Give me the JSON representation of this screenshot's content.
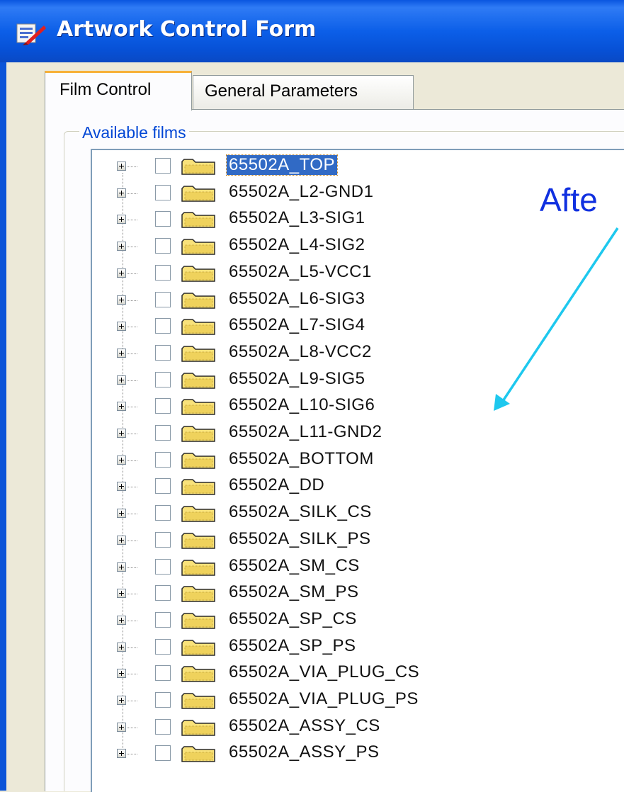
{
  "window": {
    "title": "Artwork Control Form"
  },
  "tabs": [
    {
      "label": "Film Control",
      "active": true
    },
    {
      "label": "General Parameters",
      "active": false
    }
  ],
  "group": {
    "label": "Available films"
  },
  "films": [
    {
      "name": "65502A_TOP",
      "selected": true
    },
    {
      "name": "65502A_L2-GND1"
    },
    {
      "name": "65502A_L3-SIG1"
    },
    {
      "name": "65502A_L4-SIG2"
    },
    {
      "name": "65502A_L5-VCC1"
    },
    {
      "name": "65502A_L6-SIG3"
    },
    {
      "name": "65502A_L7-SIG4"
    },
    {
      "name": "65502A_L8-VCC2"
    },
    {
      "name": "65502A_L9-SIG5"
    },
    {
      "name": "65502A_L10-SIG6"
    },
    {
      "name": "65502A_L11-GND2"
    },
    {
      "name": "65502A_BOTTOM"
    },
    {
      "name": "65502A_DD"
    },
    {
      "name": "65502A_SILK_CS"
    },
    {
      "name": "65502A_SILK_PS"
    },
    {
      "name": "65502A_SM_CS"
    },
    {
      "name": "65502A_SM_PS"
    },
    {
      "name": "65502A_SP_CS"
    },
    {
      "name": "65502A_SP_PS"
    },
    {
      "name": "65502A_VIA_PLUG_CS"
    },
    {
      "name": "65502A_VIA_PLUG_PS"
    },
    {
      "name": "65502A_ASSY_CS"
    },
    {
      "name": "65502A_ASSY_PS"
    }
  ],
  "annotation": {
    "text": "Afte",
    "color": "#1030e0",
    "arrow_color": "#1ec8ee"
  },
  "icons": {
    "app": "artwork-app-icon",
    "folder": "folder-icon",
    "expand": "plus-expander-icon"
  },
  "colors": {
    "titlebar": "#0c5fe8",
    "selection": "#316ac5",
    "group_label": "#0046d5",
    "active_tab_accent": "#f7b13a"
  }
}
